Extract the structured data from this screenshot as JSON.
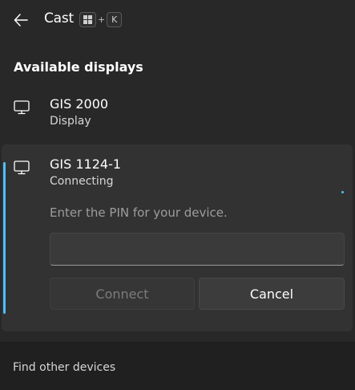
{
  "header": {
    "title": "Cast",
    "shortcut": {
      "key1_icon": "windows-logo-icon",
      "plus": "+",
      "key2": "K"
    }
  },
  "section_title": "Available displays",
  "devices": [
    {
      "name": "GIS 2000",
      "status": "Display",
      "icon": "monitor-icon"
    },
    {
      "name": "GIS 1124-1",
      "status": "Connecting",
      "icon": "monitor-icon"
    }
  ],
  "pin_prompt": {
    "label": "Enter the PIN for your device.",
    "input_value": "",
    "connect_label": "Connect",
    "cancel_label": "Cancel"
  },
  "footer": {
    "link": "Find other devices"
  },
  "colors": {
    "accent": "#4cc2ff",
    "background": "#282828",
    "card": "#323232"
  }
}
